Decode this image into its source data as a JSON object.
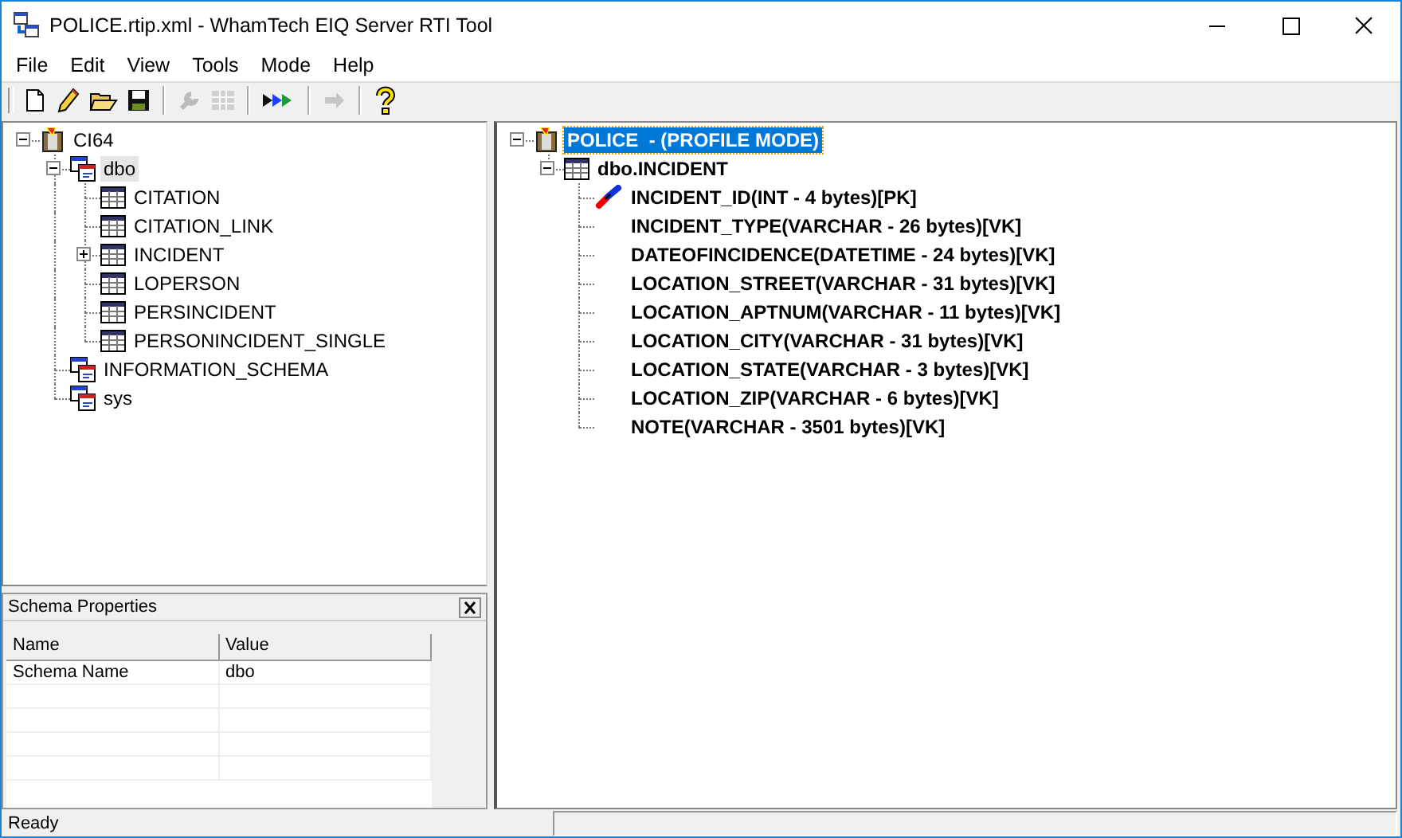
{
  "window": {
    "title": "POLICE.rtip.xml - WhamTech EIQ Server RTI Tool"
  },
  "menu": [
    "File",
    "Edit",
    "View",
    "Tools",
    "Mode",
    "Help"
  ],
  "toolbar": [
    {
      "kind": "new",
      "disabled": false
    },
    {
      "kind": "edit",
      "disabled": false
    },
    {
      "kind": "open",
      "disabled": false
    },
    {
      "kind": "save",
      "disabled": false
    },
    {
      "kind": "sep"
    },
    {
      "kind": "wrench",
      "disabled": true
    },
    {
      "kind": "grid",
      "disabled": true
    },
    {
      "kind": "sep"
    },
    {
      "kind": "run",
      "disabled": false
    },
    {
      "kind": "sep"
    },
    {
      "kind": "arrow",
      "disabled": true
    },
    {
      "kind": "sep"
    },
    {
      "kind": "help",
      "disabled": false
    }
  ],
  "schema_tree": [
    {
      "label": "CI64",
      "kind": "database",
      "selected": false,
      "expanded": true,
      "children": [
        {
          "label": "dbo",
          "kind": "schema",
          "selected": true,
          "expanded": true,
          "children": [
            {
              "label": "CITATION",
              "kind": "table",
              "selected": false
            },
            {
              "label": "CITATION_LINK",
              "kind": "table",
              "selected": false
            },
            {
              "label": "INCIDENT",
              "kind": "table",
              "selected": false,
              "expanded": false
            },
            {
              "label": "LOPERSON",
              "kind": "table",
              "selected": false
            },
            {
              "label": "PERSINCIDENT",
              "kind": "table",
              "selected": false
            },
            {
              "label": "PERSONINCIDENT_SINGLE",
              "kind": "table",
              "selected": false
            }
          ]
        },
        {
          "label": "INFORMATION_SCHEMA",
          "kind": "schema",
          "selected": false
        },
        {
          "label": "sys",
          "kind": "schema",
          "selected": false
        }
      ]
    }
  ],
  "properties": {
    "title": "Schema Properties",
    "columns": [
      "Name",
      "Value"
    ],
    "rows": [
      [
        "Schema Name",
        "dbo"
      ]
    ]
  },
  "profile_tree": [
    {
      "label": "POLICE  - (PROFILE MODE)",
      "kind": "database",
      "selected": true,
      "expanded": true,
      "children": [
        {
          "label": "dbo.INCIDENT",
          "kind": "table",
          "selected": false,
          "expanded": true,
          "children": [
            {
              "label": "INCIDENT_ID(INT - 4 bytes)[PK]",
              "kind": "key",
              "selected": false
            },
            {
              "label": "INCIDENT_TYPE(VARCHAR - 26 bytes)[VK]",
              "kind": "column",
              "selected": false
            },
            {
              "label": "DATEOFINCIDENCE(DATETIME - 24 bytes)[VK]",
              "kind": "column",
              "selected": false
            },
            {
              "label": "LOCATION_STREET(VARCHAR - 31 bytes)[VK]",
              "kind": "column",
              "selected": false
            },
            {
              "label": "LOCATION_APTNUM(VARCHAR - 11 bytes)[VK]",
              "kind": "column",
              "selected": false
            },
            {
              "label": "LOCATION_CITY(VARCHAR - 31 bytes)[VK]",
              "kind": "column",
              "selected": false
            },
            {
              "label": "LOCATION_STATE(VARCHAR - 3 bytes)[VK]",
              "kind": "column",
              "selected": false
            },
            {
              "label": "LOCATION_ZIP(VARCHAR - 6 bytes)[VK]",
              "kind": "column",
              "selected": false
            },
            {
              "label": "NOTE(VARCHAR - 3501 bytes)[VK]",
              "kind": "column",
              "selected": false
            }
          ]
        }
      ]
    }
  ],
  "status_bar": "Ready"
}
